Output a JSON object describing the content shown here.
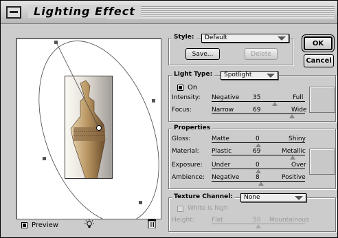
{
  "window": {
    "title": "Lighting Effect"
  },
  "style": {
    "label": "Style:",
    "selected": "Default",
    "save_label": "Save...",
    "delete_label": "Delete"
  },
  "buttons": {
    "ok_label": "OK",
    "cancel_label": "Cancel"
  },
  "light_type": {
    "label": "Light Type:",
    "selected": "Spotlight",
    "on_label": "On",
    "on_checked": true,
    "sliders": [
      {
        "label": "Intensity:",
        "low": "Negative",
        "value": "35",
        "high": "Full"
      },
      {
        "label": "Focus:",
        "low": "Narrow",
        "value": "69",
        "high": "Wide"
      }
    ]
  },
  "properties": {
    "label": "Properties",
    "sliders": [
      {
        "label": "Gloss:",
        "low": "Matte",
        "value": "0",
        "high": "Shiny"
      },
      {
        "label": "Material:",
        "low": "Plastic",
        "value": "69",
        "high": "Metallic"
      },
      {
        "label": "Exposure:",
        "low": "Under",
        "value": "0",
        "high": "Over"
      },
      {
        "label": "Ambience:",
        "low": "Negative",
        "value": "8",
        "high": "Positive"
      }
    ]
  },
  "texture": {
    "label": "Texture Channel:",
    "selected": "None",
    "white_high_label": "White is high",
    "height": {
      "label": "Height:",
      "low": "Flat",
      "value": "50",
      "high": "Mountainous"
    }
  },
  "preview": {
    "checkbox_label": "Preview",
    "checked": true
  },
  "icons": {
    "bulb": "light-bulb-icon",
    "trash": "trash-icon"
  },
  "colors": {
    "window_bg": "#cccccc",
    "desktop_blue": "#3a6fa8"
  }
}
